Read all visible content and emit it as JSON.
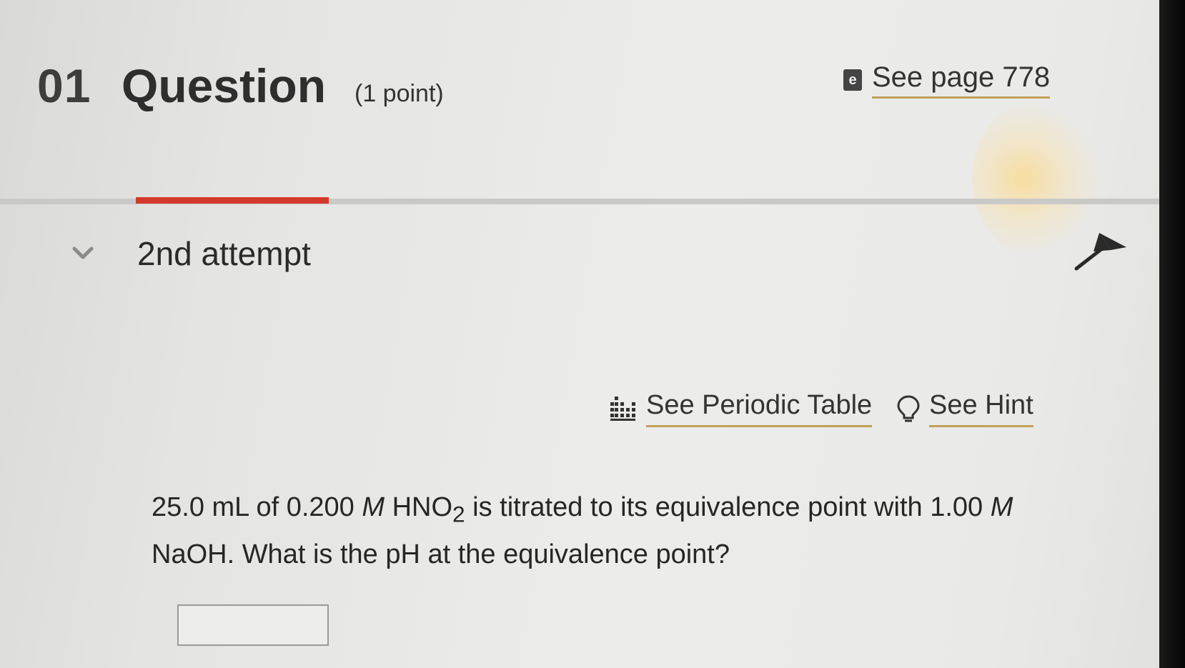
{
  "header": {
    "number": "01",
    "title": "Question",
    "points": "(1 point)"
  },
  "ebook": {
    "icon_letter": "e",
    "label": "See page 778"
  },
  "attempt": {
    "label": "2nd attempt"
  },
  "resources": {
    "periodic_table": "See Periodic Table",
    "hint": "See Hint"
  },
  "question": {
    "part1": "25.0 mL of 0.200 ",
    "unit1": "M",
    "part2": " HNO",
    "subscript": "2",
    "part3": " is titrated to its equivalence point with 1.00 ",
    "unit2": "M",
    "part4": " NaOH. What is the pH at the equivalence point?"
  },
  "answer": {
    "value": ""
  },
  "colors": {
    "tab_active": "#d23a2c",
    "link_underline": "#c2a15a"
  },
  "icons": {
    "ebook": "ebook-icon",
    "chevron": "chevron-down-icon",
    "pin": "pin-icon",
    "periodic": "periodic-table-icon",
    "hint": "lightbulb-icon"
  }
}
